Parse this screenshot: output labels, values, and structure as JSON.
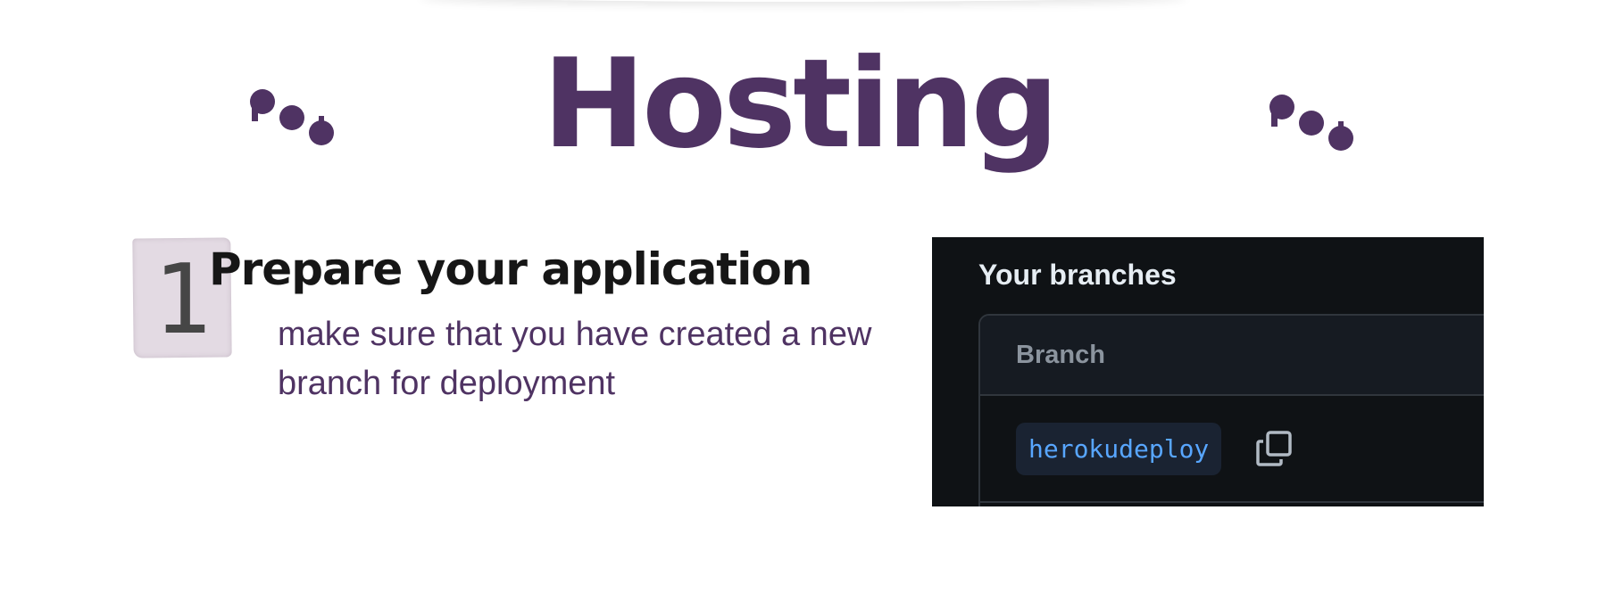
{
  "header": {
    "title": "Hosting",
    "accent_color": "#4f3363"
  },
  "step": {
    "number": "1",
    "title": "Prepare your application",
    "description": "make sure that you have created a new branch for deployment"
  },
  "screenshot": {
    "heading": "Your branches",
    "table": {
      "column_header": "Branch",
      "rows": [
        {
          "branch": "herokudeploy"
        }
      ]
    },
    "copy_icon": "copy-icon"
  }
}
